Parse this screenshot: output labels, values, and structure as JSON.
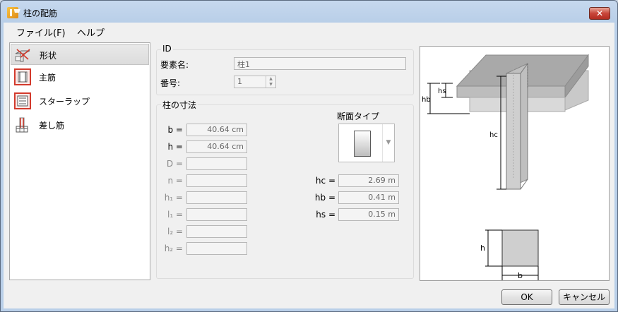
{
  "window": {
    "title": "柱の配筋"
  },
  "titlebar": {
    "close_glyph": "✕"
  },
  "menu": [
    {
      "label": "ファイル(F)"
    },
    {
      "label": "ヘルプ"
    }
  ],
  "nav": {
    "items": [
      {
        "label": "形状",
        "icon": "shape-icon",
        "selected": true
      },
      {
        "label": "主筋",
        "icon": "main-rebar-icon"
      },
      {
        "label": "スターラップ",
        "icon": "stirrup-icon"
      },
      {
        "label": "差し筋",
        "icon": "dowel-icon"
      }
    ]
  },
  "id_group": {
    "title": "ID",
    "element_name_label": "要素名:",
    "element_name_value": "柱1",
    "number_label": "番号:",
    "number_value": "1",
    "spin_up": "▲",
    "spin_down": "▼"
  },
  "dims_group": {
    "title": "柱の寸法",
    "fields": [
      {
        "label": "b =",
        "value": "40.64 cm",
        "enabled": true
      },
      {
        "label": "h =",
        "value": "40.64 cm",
        "enabled": true
      },
      {
        "label": "D =",
        "value": "",
        "enabled": false
      },
      {
        "label": "n =",
        "value": "",
        "enabled": false
      },
      {
        "label": "h₁ =",
        "value": "",
        "enabled": false
      },
      {
        "label": "l₁ =",
        "value": "",
        "enabled": false
      },
      {
        "label": "l₂ =",
        "value": "",
        "enabled": false
      },
      {
        "label": "h₂ =",
        "value": "",
        "enabled": false
      }
    ],
    "section_type_label": "断面タイプ",
    "section_arrow": "▼",
    "heights": [
      {
        "label": "hc =",
        "value": "2.69 m"
      },
      {
        "label": "hb =",
        "value": "0.41 m"
      },
      {
        "label": "hs =",
        "value": "0.15 m"
      }
    ]
  },
  "preview": {
    "labels": {
      "hs": "hs",
      "hb": "hb",
      "hc": "hc",
      "h": "h",
      "b": "b"
    }
  },
  "buttons": {
    "ok": "OK",
    "cancel": "キャンセル"
  },
  "colors": {
    "titlebar": "#b9cfe8",
    "close": "#c8463a",
    "icon_red": "#d33a2c"
  }
}
